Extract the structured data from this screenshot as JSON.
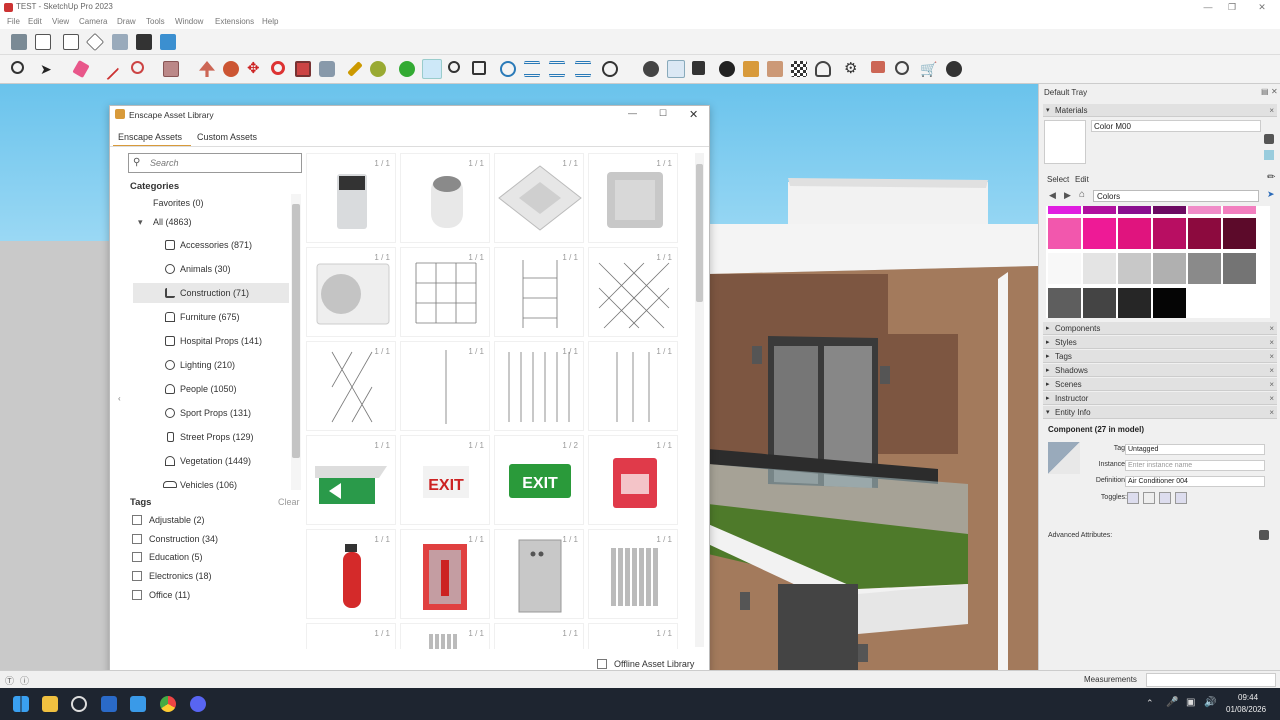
{
  "app": {
    "title": "TEST - SketchUp Pro 2023",
    "menu": [
      "File",
      "Edit",
      "View",
      "Camera",
      "Draw",
      "Tools",
      "Window",
      "Extensions",
      "Help"
    ]
  },
  "asset_library": {
    "title": "Enscape Asset Library",
    "tabs": [
      "Enscape Assets",
      "Custom Assets"
    ],
    "search_placeholder": "Search",
    "categories_heading": "Categories",
    "favorites": "Favorites (0)",
    "all": "All (4863)",
    "categories": [
      {
        "label": "Accessories (871)",
        "icon": "accessories-icon"
      },
      {
        "label": "Animals (30)",
        "icon": "paw-icon"
      },
      {
        "label": "Construction (71)",
        "icon": "construction-icon"
      },
      {
        "label": "Furniture (675)",
        "icon": "chair-icon"
      },
      {
        "label": "Hospital Props (141)",
        "icon": "hospital-bed-icon"
      },
      {
        "label": "Lighting (210)",
        "icon": "bulb-icon"
      },
      {
        "label": "People (1050)",
        "icon": "person-icon"
      },
      {
        "label": "Sport Props (131)",
        "icon": "ball-icon"
      },
      {
        "label": "Street Props (129)",
        "icon": "street-sign-icon"
      },
      {
        "label": "Vegetation (1449)",
        "icon": "plant-icon"
      },
      {
        "label": "Vehicles (106)",
        "icon": "car-icon"
      }
    ],
    "tags_heading": "Tags",
    "clear_label": "Clear",
    "tags": [
      "Adjustable (2)",
      "Construction (34)",
      "Education (5)",
      "Electronics (18)",
      "Office (11)"
    ],
    "assets": [
      {
        "count": "1 / 1",
        "kind": "air-purifier-dark"
      },
      {
        "count": "1 / 1",
        "kind": "air-purifier-round"
      },
      {
        "count": "1 / 1",
        "kind": "ceiling-vent"
      },
      {
        "count": "1 / 1",
        "kind": "wall-vent"
      },
      {
        "count": "1 / 1",
        "kind": "ac-outdoor-unit"
      },
      {
        "count": "1 / 1",
        "kind": "cable-grid"
      },
      {
        "count": "1 / 1",
        "kind": "cable-grid-narrow"
      },
      {
        "count": "1 / 1",
        "kind": "cable-diamond"
      },
      {
        "count": "1 / 1",
        "kind": "cable-diamond-narrow"
      },
      {
        "count": "1 / 1",
        "kind": "cable-single"
      },
      {
        "count": "1 / 1",
        "kind": "cable-vertical"
      },
      {
        "count": "1 / 1",
        "kind": "cable-vertical-sparse"
      },
      {
        "count": "1 / 1",
        "kind": "exit-sign-arrow"
      },
      {
        "count": "1 / 1",
        "kind": "exit-sign-red"
      },
      {
        "count": "1 / 2",
        "kind": "exit-sign-green"
      },
      {
        "count": "1 / 1",
        "kind": "fire-alarm"
      },
      {
        "count": "1 / 1",
        "kind": "fire-extinguisher"
      },
      {
        "count": "1 / 1",
        "kind": "extinguisher-cabinet"
      },
      {
        "count": "1 / 1",
        "kind": "electrical-panel"
      },
      {
        "count": "1 / 1",
        "kind": "radiator"
      },
      {
        "count": "1 / 1",
        "kind": "partial"
      },
      {
        "count": "1 / 1",
        "kind": "partial"
      },
      {
        "count": "1 / 1",
        "kind": "partial"
      },
      {
        "count": "1 / 1",
        "kind": "partial"
      }
    ],
    "offline_label": "Offline Asset Library"
  },
  "tray": {
    "title": "Default Tray",
    "materials_label": "Materials",
    "material_name": "Color M00",
    "select_tab": "Select",
    "edit_tab": "Edit",
    "collection": "Colors",
    "swatches": [
      [
        "#e01ee0",
        "#b0109e",
        "#8a0f8f",
        "#6c0a62",
        "#f08cc8",
        "#f27fbf"
      ],
      [
        "#f257ad",
        "#ee1a96",
        "#e0147e",
        "#b80e62",
        "#8c0a3e",
        "#5c0a2a"
      ],
      [
        "#f8f8f8",
        "#e4e4e4",
        "#c8c8c8",
        "#b0b0b0",
        "#8a8a8a",
        "#747474"
      ],
      [
        "#5e5e5e",
        "#444444",
        "#262626",
        "#050505"
      ]
    ],
    "panels": [
      "Components",
      "Styles",
      "Tags",
      "Shadows",
      "Scenes",
      "Instructor",
      "Entity Info"
    ],
    "entity": {
      "heading": "Component (27 in model)",
      "tag_label": "Tag:",
      "tag_value": "Untagged",
      "instance_label": "Instance:",
      "instance_placeholder": "Enter instance name",
      "definition_label": "Definition:",
      "definition_value": "Air Conditioner 004",
      "toggles_label": "Toggles:",
      "advanced": "Advanced Attributes:"
    }
  },
  "status": {
    "measurements": "Measurements"
  },
  "taskbar": {
    "time": "09:44",
    "date": "01/08/2026"
  }
}
